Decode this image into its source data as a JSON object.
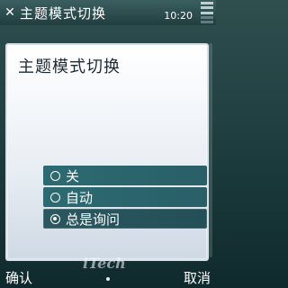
{
  "status_bar": {
    "title": "主题模式切换",
    "clock": "10:20"
  },
  "dialog": {
    "title": "主题模式切换",
    "options": [
      {
        "label": "关",
        "selected": false
      },
      {
        "label": "自动",
        "selected": false
      },
      {
        "label": "总是询问",
        "selected": true
      }
    ]
  },
  "softkeys": {
    "left": "确认",
    "right": "取消"
  },
  "watermark": "iTech",
  "icons": {
    "close": "close-icon",
    "battery": "battery-icon",
    "radio_on": "radio-selected-icon",
    "radio_off": "radio-unselected-icon"
  },
  "colors": {
    "background": "#1f3f40",
    "dialog": "#ffffff",
    "option_bg": "#2c6b72",
    "text": "#ffffff"
  }
}
